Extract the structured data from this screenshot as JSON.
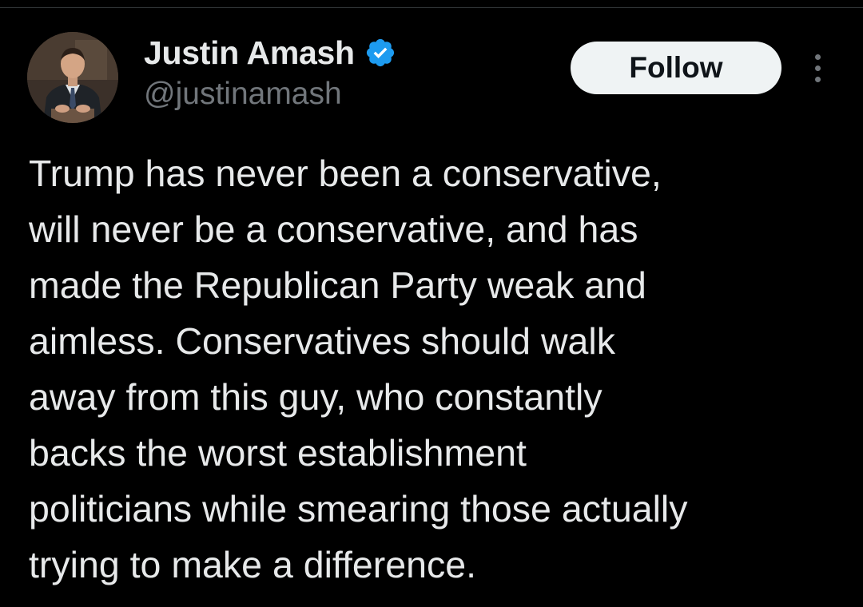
{
  "author": {
    "display_name": "Justin Amash",
    "handle": "@justinamash",
    "verified": true,
    "avatar_icon": "profile-photo"
  },
  "actions": {
    "follow_label": "Follow",
    "more_icon": "more-options-icon"
  },
  "tweet": {
    "lines": [
      "Trump has never been a conservative,",
      "will never be a conservative, and has",
      "made the Republican Party weak and",
      "aimless. Conservatives should walk",
      "away from this guy, who constantly",
      "backs the worst establishment",
      "politicians while smearing those actually",
      "trying to make a difference."
    ]
  },
  "colors": {
    "background": "#000000",
    "text_primary": "#e7e9ea",
    "text_secondary": "#71767b",
    "verified_blue": "#1d9bf0",
    "follow_button_bg": "#eff3f4",
    "follow_button_text": "#0f1419"
  }
}
